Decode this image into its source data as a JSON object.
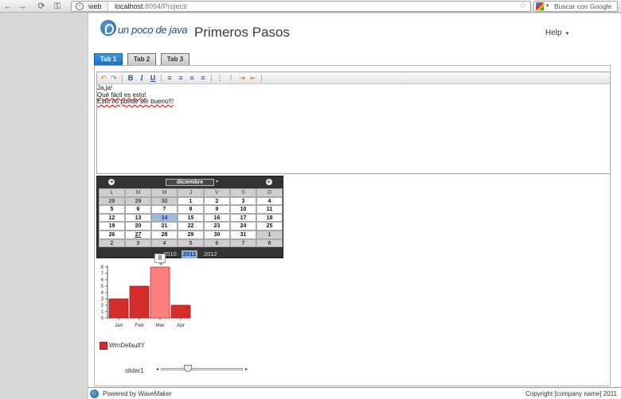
{
  "browser": {
    "url_chip_label": "web",
    "url_host": "localhost",
    "url_path": ":8094/Project/",
    "search_placeholder": "Buscar con Google",
    "back_glyph": "←",
    "forward_glyph": "→",
    "reload_glyph": "⟳",
    "key_glyph": "⚿",
    "star_glyph": "☆",
    "search_caret": "▾"
  },
  "header": {
    "logo_text": "un poco de java",
    "title": "Primeros Pasos",
    "help_label": "Help",
    "help_caret": "▾"
  },
  "tabs": [
    {
      "label": "Tab 1",
      "active": true
    },
    {
      "label": "Tab 2",
      "active": false
    },
    {
      "label": "Tab 3",
      "active": false
    }
  ],
  "editor": {
    "toolbar": {
      "undo": "↶",
      "redo": "↷",
      "bold": "B",
      "italic": "I",
      "underline": "U",
      "align_left": "≡",
      "align_center": "≡",
      "align_right": "≡",
      "justify": "≡",
      "ordered_list": "⋮",
      "unordered_list": "⁝",
      "indent": "⇥",
      "outdent": "⇤"
    },
    "lines": [
      "Ja,ja!",
      "Qué fácil es esto!",
      "Esto no puede ser bueno!!!"
    ]
  },
  "calendar": {
    "month": "diciembre",
    "month_caret": "▾",
    "prev_glyph": "◂",
    "next_glyph": "▸",
    "weekdays": [
      "L",
      "M",
      "M",
      "J",
      "V",
      "S",
      "D"
    ],
    "weeks": [
      [
        {
          "d": "28",
          "o": true
        },
        {
          "d": "29",
          "o": true
        },
        {
          "d": "30",
          "o": true
        },
        {
          "d": "1"
        },
        {
          "d": "2"
        },
        {
          "d": "3"
        },
        {
          "d": "4"
        }
      ],
      [
        {
          "d": "5"
        },
        {
          "d": "6"
        },
        {
          "d": "7"
        },
        {
          "d": "8"
        },
        {
          "d": "9"
        },
        {
          "d": "10"
        },
        {
          "d": "11"
        }
      ],
      [
        {
          "d": "12"
        },
        {
          "d": "13"
        },
        {
          "d": "14",
          "s": true
        },
        {
          "d": "15"
        },
        {
          "d": "16"
        },
        {
          "d": "17"
        },
        {
          "d": "18"
        }
      ],
      [
        {
          "d": "19"
        },
        {
          "d": "20"
        },
        {
          "d": "21"
        },
        {
          "d": "22"
        },
        {
          "d": "23"
        },
        {
          "d": "24"
        },
        {
          "d": "25"
        }
      ],
      [
        {
          "d": "26"
        },
        {
          "d": "27",
          "t": true
        },
        {
          "d": "28"
        },
        {
          "d": "29"
        },
        {
          "d": "30"
        },
        {
          "d": "31"
        },
        {
          "d": "1",
          "o": true
        }
      ],
      [
        {
          "d": "2",
          "o": true
        },
        {
          "d": "3",
          "o": true
        },
        {
          "d": "4",
          "o": true
        },
        {
          "d": "5",
          "o": true
        },
        {
          "d": "6",
          "o": true
        },
        {
          "d": "7",
          "o": true
        },
        {
          "d": "8",
          "o": true
        }
      ]
    ],
    "years": [
      {
        "label": "2010",
        "selected": false
      },
      {
        "label": "2011",
        "selected": true
      },
      {
        "label": "2012",
        "selected": false
      }
    ]
  },
  "chart_data": {
    "type": "bar",
    "categories": [
      "Jan",
      "Feb",
      "Mar",
      "Apr"
    ],
    "series": [
      {
        "name": "WmDefaultY",
        "values": [
          3,
          5,
          8,
          2
        ]
      }
    ],
    "ylim": [
      0,
      8
    ],
    "yticks": [
      0,
      1,
      2,
      3,
      4,
      5,
      6,
      7,
      8
    ],
    "highlighted_index": 2,
    "tooltip_value": "8",
    "bar_color": "#d42b2b",
    "highlight_color": "#ff7f7f",
    "legend": "bottom-left",
    "grid": false
  },
  "slider": {
    "label": "slider1",
    "value_fraction": 0.33,
    "left_glyph": "◂",
    "right_glyph": "▸"
  },
  "footer": {
    "powered_by": "Powered by WaveMaker",
    "copyright": "Copyright [company name] 2011"
  }
}
